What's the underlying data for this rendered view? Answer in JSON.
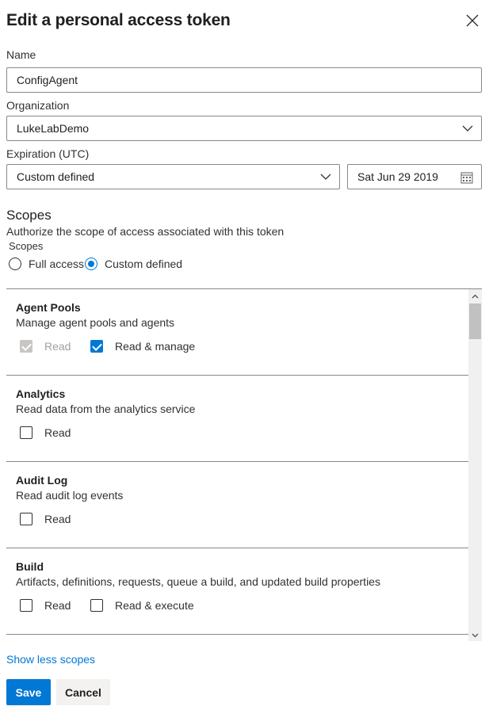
{
  "dialog": {
    "title": "Edit a personal access token"
  },
  "name_field": {
    "label": "Name",
    "value": "ConfigAgent"
  },
  "organization": {
    "label": "Organization",
    "value": "LukeLabDemo"
  },
  "expiration": {
    "label": "Expiration (UTC)",
    "value": "Custom defined",
    "date": "Sat Jun 29 2019"
  },
  "scopes": {
    "title": "Scopes",
    "description": "Authorize the scope of access associated with this token",
    "sub_label": "Scopes",
    "options": [
      {
        "label": "Full access",
        "selected": false
      },
      {
        "label": "Custom defined",
        "selected": true
      }
    ],
    "items": [
      {
        "name": "Agent Pools",
        "description": "Manage agent pools and agents",
        "permissions": [
          {
            "label": "Read",
            "checked": true,
            "disabled": true
          },
          {
            "label": "Read & manage",
            "checked": true,
            "disabled": false
          }
        ]
      },
      {
        "name": "Analytics",
        "description": "Read data from the analytics service",
        "permissions": [
          {
            "label": "Read",
            "checked": false,
            "disabled": false
          }
        ]
      },
      {
        "name": "Audit Log",
        "description": "Read audit log events",
        "permissions": [
          {
            "label": "Read",
            "checked": false,
            "disabled": false
          }
        ]
      },
      {
        "name": "Build",
        "description": "Artifacts, definitions, requests, queue a build, and updated build properties",
        "permissions": [
          {
            "label": "Read",
            "checked": false,
            "disabled": false
          },
          {
            "label": "Read & execute",
            "checked": false,
            "disabled": false
          }
        ]
      }
    ]
  },
  "footer": {
    "toggle_link": "Show less scopes",
    "save_label": "Save",
    "cancel_label": "Cancel"
  },
  "colors": {
    "accent": "#0078d4",
    "border": "#8a8886",
    "disabled": "#c8c6c4"
  },
  "icons": {
    "close": "close-icon",
    "dropdown": "chevron-down-icon",
    "date": "calendar-icon"
  }
}
